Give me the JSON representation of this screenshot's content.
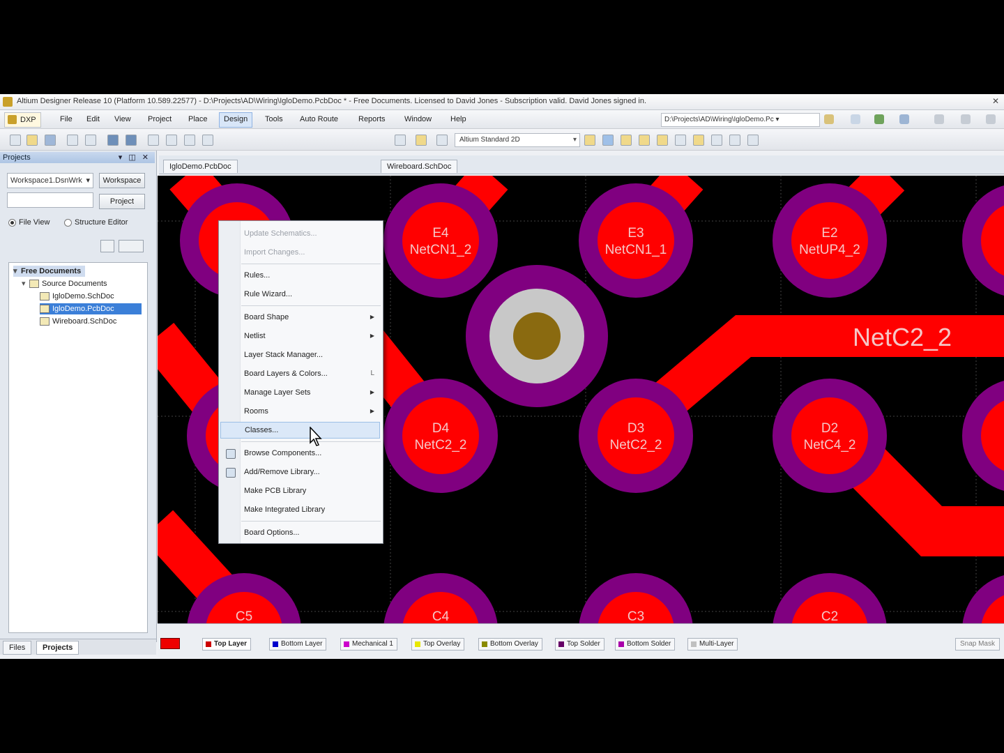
{
  "window": {
    "title": "Altium Designer Release 10 (Platform 10.589.22577) - D:\\Projects\\AD\\Wiring\\IgloDemo.PcbDoc * - Free Documents. Licensed to David Jones - Subscription valid. David Jones signed in."
  },
  "menubar": {
    "dxp": "DXP",
    "items": [
      "File",
      "Edit",
      "View",
      "Project",
      "Place",
      "Design",
      "Tools",
      "Auto Route",
      "Reports",
      "Window",
      "Help"
    ],
    "path": "D:\\Projects\\AD\\Wiring\\IgloDemo.Pc ▾"
  },
  "toolbar": {
    "layer_set": "Altium Standard 2D"
  },
  "projects_panel": {
    "title": "Projects",
    "controls": "▾ ◫ ✕",
    "workspace": "Workspace1.DsnWrk",
    "workspace_button": "Workspace",
    "project_button": "Project",
    "file_view": "File View",
    "structure_editor": "Structure Editor",
    "tree": {
      "group": "Free Documents",
      "subgroup": "Source Documents",
      "files": [
        "IgloDemo.SchDoc",
        "IgloDemo.PcbDoc",
        "Wireboard.SchDoc"
      ],
      "selected_index": 1
    }
  },
  "bottom_tabs": [
    "Files",
    "Projects"
  ],
  "doc_tabs": [
    "IgloDemo.PcbDoc",
    "Wireboard.SchDoc"
  ],
  "design_menu": {
    "items": [
      {
        "label": "Update Schematics...",
        "disabled": true
      },
      {
        "label": "Import Changes...",
        "disabled": true
      },
      {
        "sep": true
      },
      {
        "label": "Rules..."
      },
      {
        "label": "Rule Wizard..."
      },
      {
        "sep": true
      },
      {
        "label": "Board Shape",
        "submenu": true
      },
      {
        "label": "Netlist",
        "submenu": true
      },
      {
        "label": "Layer Stack Manager..."
      },
      {
        "label": "Board Layers & Colors...",
        "shortcut": "L"
      },
      {
        "label": "Manage Layer Sets",
        "submenu": true
      },
      {
        "label": "Rooms",
        "submenu": true
      },
      {
        "label": "Classes...",
        "highlight": true
      },
      {
        "sep": true
      },
      {
        "label": "Browse Components...",
        "icon": "browse-components-icon"
      },
      {
        "label": "Add/Remove Library...",
        "icon": "library-icon"
      },
      {
        "label": "Make PCB Library"
      },
      {
        "label": "Make Integrated Library"
      },
      {
        "sep": true
      },
      {
        "label": "Board Options..."
      }
    ]
  },
  "pcb": {
    "colors": {
      "top_layer": "#ff0000",
      "multi_layer": "#800080",
      "via_ring": "#c8c8c8",
      "drill": "#8a6a10",
      "grid": "#707070"
    },
    "pads": [
      {
        "ref": "E4",
        "net": "NetCN1_2"
      },
      {
        "ref": "E3",
        "net": "NetCN1_1"
      },
      {
        "ref": "E2",
        "net": "NetUP4_2"
      },
      {
        "ref": "D4",
        "net": "NetC2_2"
      },
      {
        "ref": "D3",
        "net": "NetC2_2"
      },
      {
        "ref": "D2",
        "net": "NetC4_2"
      },
      {
        "ref": "C5",
        "net": ""
      },
      {
        "ref": "C4",
        "net": ""
      },
      {
        "ref": "C3",
        "net": ""
      },
      {
        "ref": "C2",
        "net": ""
      }
    ],
    "track_label": "NetC2_2"
  },
  "layer_tabs": [
    {
      "label": "Top Layer",
      "color": "#cc0000",
      "active": true
    },
    {
      "label": "Bottom Layer",
      "color": "#0000cc"
    },
    {
      "label": "Mechanical 1",
      "color": "#cc00cc"
    },
    {
      "label": "Top Overlay",
      "color": "#e8e800"
    },
    {
      "label": "Bottom Overlay",
      "color": "#8a8a00"
    },
    {
      "label": "Top Solder",
      "color": "#660066"
    },
    {
      "label": "Bottom Solder",
      "color": "#aa00aa"
    },
    {
      "label": "Multi-Layer",
      "color": "#c0c0c0"
    }
  ],
  "status": {
    "snap": "Snap  Mask"
  }
}
